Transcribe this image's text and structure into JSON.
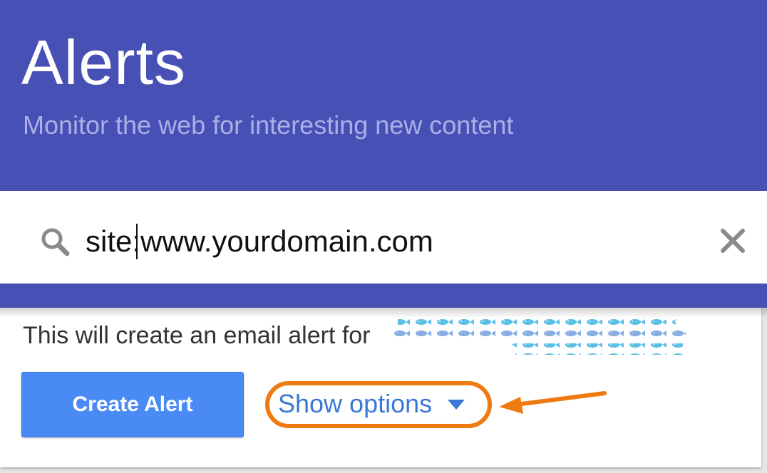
{
  "header": {
    "title": "Alerts",
    "subtitle": "Monitor the web for interesting new content"
  },
  "search": {
    "value": "site:www.yourdomain.com",
    "icon": "search-icon",
    "clear_icon": "close-icon"
  },
  "info": {
    "text": "This will create an email alert for"
  },
  "actions": {
    "create_label": "Create Alert",
    "show_options_label": "Show options",
    "show_options_icon": "caret-down-icon"
  },
  "annotation": {
    "color": "#f07a12"
  },
  "colors": {
    "header_bg": "#4750b5",
    "subtitle": "#aab0e6",
    "button": "#4a8af4",
    "link": "#3a78d6"
  }
}
